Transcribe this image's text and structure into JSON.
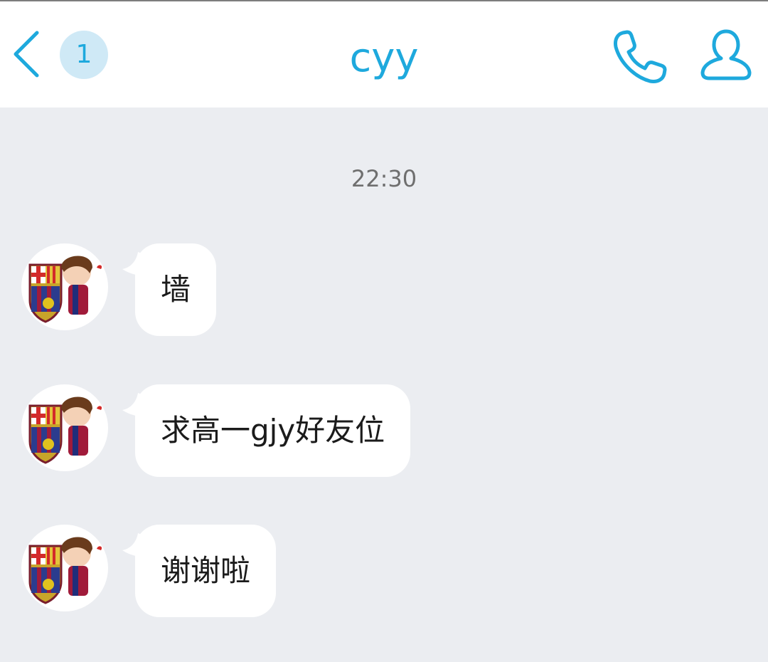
{
  "header": {
    "back_icon": "chevron-left-icon",
    "unread_count": "1",
    "title": "cyy",
    "call_icon": "phone-icon",
    "profile_icon": "person-icon",
    "accent_color": "#1ea9dd"
  },
  "chat": {
    "timestamp": "22:30",
    "messages": [
      {
        "text": "墙"
      },
      {
        "text": "求高一gjy好友位"
      },
      {
        "text": "谢谢啦"
      }
    ]
  },
  "colors": {
    "background": "#ebedf1",
    "bubble": "#ffffff",
    "badge": "#cfe9f6"
  }
}
